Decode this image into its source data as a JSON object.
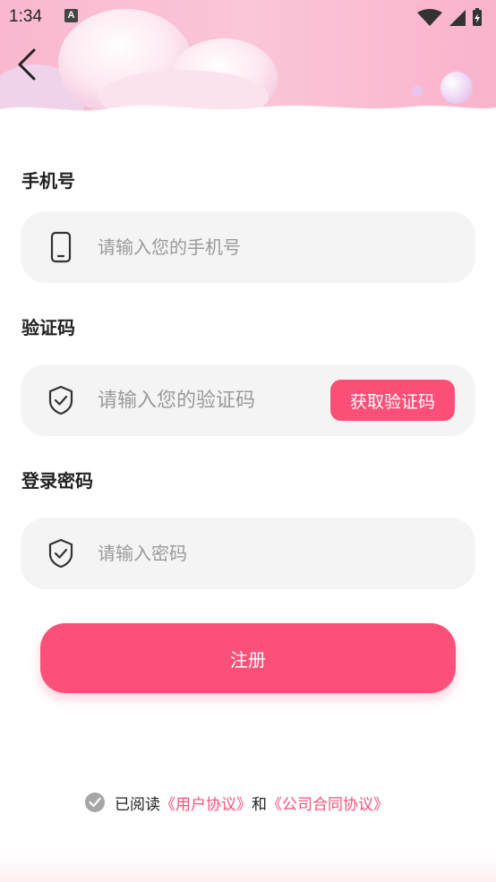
{
  "status_bar": {
    "time": "1:34",
    "notification_badge": "A"
  },
  "form": {
    "phone": {
      "label": "手机号",
      "placeholder": "请输入您的手机号",
      "value": ""
    },
    "code": {
      "label": "验证码",
      "placeholder": "请输入您的验证码",
      "value": "",
      "button": "获取验证码"
    },
    "password": {
      "label": "登录密码",
      "placeholder": "请输入密码",
      "value": ""
    }
  },
  "register_button": "注册",
  "agreement": {
    "prefix": "已阅读",
    "user_agreement": "《用户协议》",
    "connector": "和",
    "company_contract": "《公司合同协议》"
  },
  "colors": {
    "accent": "#fb4f78",
    "field_bg": "#f4f4f4",
    "header_pink": "#f9b9cf"
  },
  "icons": [
    "back-arrow-icon",
    "phone-icon",
    "shield-check-icon",
    "checkbox-checked-icon",
    "wifi-icon",
    "signal-icon",
    "battery-icon"
  ]
}
